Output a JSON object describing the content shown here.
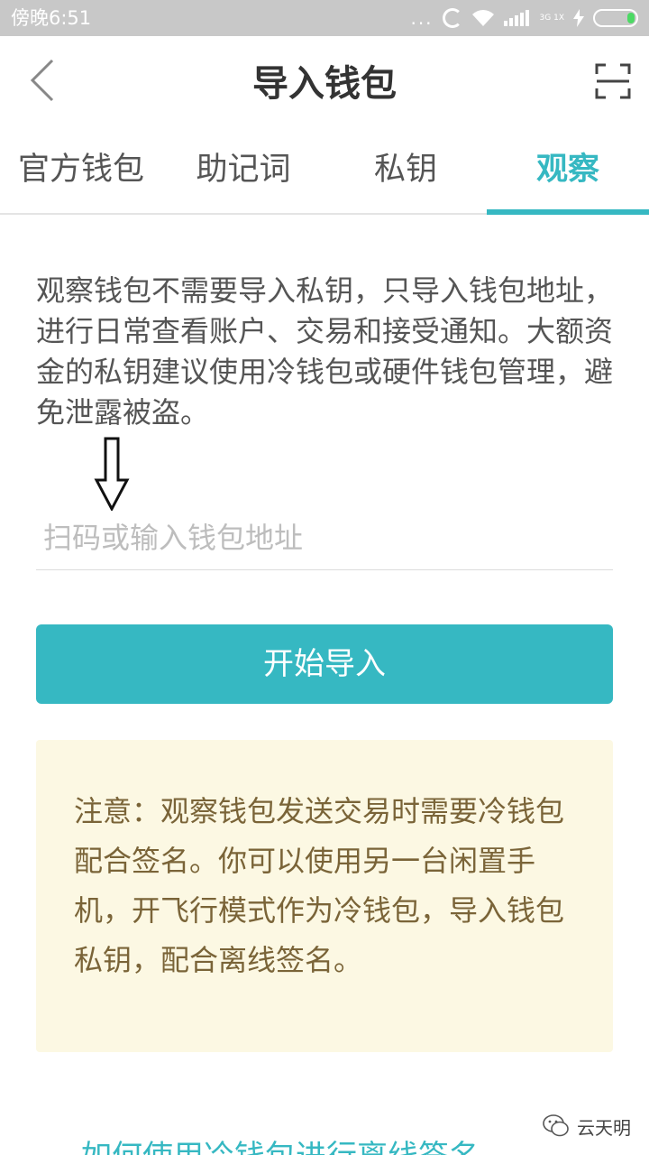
{
  "status_bar": {
    "time": "傍晚6:51",
    "dots": "...",
    "network_label": "3G 1X",
    "icons": [
      "sync-icon",
      "wifi-icon",
      "signal-icon",
      "charging-icon",
      "battery-icon"
    ]
  },
  "header": {
    "title": "导入钱包",
    "back_icon": "chevron-left-icon",
    "scan_icon": "scan-icon"
  },
  "tabs": [
    {
      "label": "官方钱包",
      "active": false
    },
    {
      "label": "助记词",
      "active": false
    },
    {
      "label": "私钥",
      "active": false
    },
    {
      "label": "观察",
      "active": true
    }
  ],
  "description": "观察钱包不需要导入私钥，只导入钱包地址，进行日常查看账户、交易和接受通知。大额资金的私钥建议使用冷钱包或硬件钱包管理，避免泄露被盗。",
  "address_input": {
    "value": "",
    "placeholder": "扫码或输入钱包地址"
  },
  "import_button": {
    "label": "开始导入"
  },
  "notice": {
    "text": "注意：观察钱包发送交易时需要冷钱包配合签名。你可以使用另一台闲置手机，开飞行模式作为冷钱包，导入钱包私钥，配合离线签名。"
  },
  "watermark": {
    "label": "云天明",
    "icon": "wechat-icon"
  },
  "bottom_link": {
    "label": "如何使用冷钱包进行离线签名"
  },
  "colors": {
    "accent": "#36b8c2",
    "status_bar": "#c8c8c8",
    "notice_bg": "#fcf8e3",
    "notice_text": "#7a6438"
  }
}
